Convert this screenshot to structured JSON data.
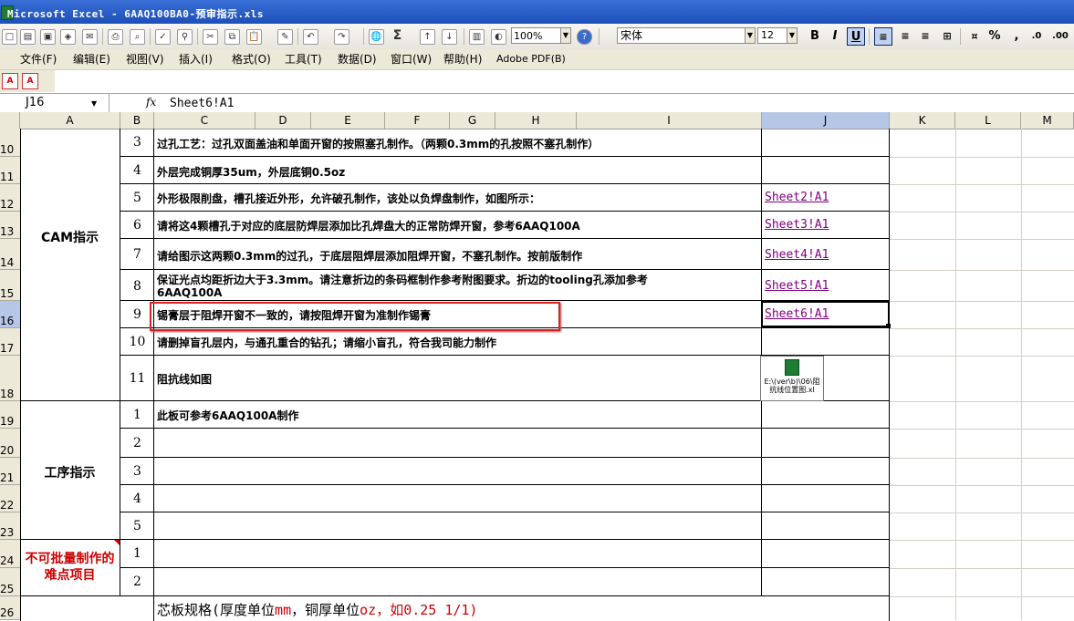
{
  "window": {
    "title": "Microsoft Excel - 6AAQ100BA0-预审指示.xls"
  },
  "toolbar": {
    "zoom": "100%",
    "font": "宋体",
    "font_size": "12",
    "bold": "B",
    "italic": "I",
    "underline": "U",
    "percent": "%",
    "comma": ",",
    "sigma": "Σ"
  },
  "menu": [
    "文件(F)",
    "编辑(E)",
    "视图(V)",
    "插入(I)",
    "格式(O)",
    "工具(T)",
    "数据(D)",
    "窗口(W)",
    "帮助(H)",
    "Adobe PDF(B)"
  ],
  "formula_bar": {
    "name_box": "J16",
    "fx": "fx",
    "content": "Sheet6!A1"
  },
  "columns": [
    "A",
    "B",
    "C",
    "D",
    "E",
    "F",
    "G",
    "H",
    "I",
    "J",
    "K",
    "L",
    "M"
  ],
  "rows": [
    "10",
    "11",
    "12",
    "13",
    "14",
    "15",
    "16",
    "17",
    "18",
    "19",
    "20",
    "21",
    "22",
    "23",
    "24",
    "25",
    "26"
  ],
  "sections": {
    "cam": "CAM指示",
    "process": "工序指示",
    "difficult": "不可批量制作的难点项目"
  },
  "cam_items": [
    {
      "n": "3",
      "text": "过孔工艺：过孔双面盖油和单面开窗的按照塞孔制作。（两颗0.3mm的孔按照不塞孔制作）",
      "link": ""
    },
    {
      "n": "4",
      "text": "外层完成铜厚35um，外层底铜0.5oz",
      "link": ""
    },
    {
      "n": "5",
      "text": "外形极限削盘，槽孔接近外形，允许破孔制作，该处以负焊盘制作，如图所示：",
      "link": "Sheet2!A1"
    },
    {
      "n": "6",
      "text": "请将这4颗槽孔于对应的底层防焊层添加比孔焊盘大的正常防焊开窗，参考6AAQ100A",
      "link": "Sheet3!A1"
    },
    {
      "n": "7",
      "text": "请给图示这两颗0.3mm的过孔，于底层阻焊层添加阻焊开窗，不塞孔制作。按前版制作",
      "link": "Sheet4!A1"
    },
    {
      "n": "8",
      "text": "保证光点均距折边大于3.3mm。请注意折边的条码框制作参考附图要求。折边的tooling孔添加参考",
      "text2": "6AAQ100A",
      "link": "Sheet5!A1"
    },
    {
      "n": "9",
      "text": "锡膏层于阻焊开窗不一致的，请按阻焊开窗为准制作锡膏",
      "link": "Sheet6!A1"
    },
    {
      "n": "10",
      "text": "请删掉盲孔层内，与通孔重合的钻孔；请缩小盲孔，符合我司能力制作",
      "link": ""
    },
    {
      "n": "11",
      "text": "阻抗线如图",
      "link": ""
    }
  ],
  "process_items": [
    {
      "n": "1",
      "text": "此板可参考6AAQ100A制作"
    },
    {
      "n": "2",
      "text": ""
    },
    {
      "n": "3",
      "text": ""
    },
    {
      "n": "4",
      "text": ""
    },
    {
      "n": "5",
      "text": ""
    }
  ],
  "difficult_items": [
    {
      "n": "1"
    },
    {
      "n": "2"
    }
  ],
  "row26": {
    "a": "芯板规格(厚度单位",
    "b": "mm",
    "c": "，铜厚单位",
    "d": "oz",
    "e": "，如0.25 1/1)"
  },
  "embedded": {
    "label": "E:\\(ver\\b)\\06\\阻抗线位置图.xl"
  },
  "colors": {
    "section_red": "#cc0000",
    "link": "#800080",
    "highlight": "#dd2222"
  }
}
